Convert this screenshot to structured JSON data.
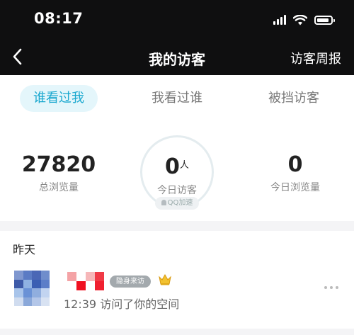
{
  "status_bar": {
    "time": "08:17"
  },
  "nav": {
    "title": "我的访客",
    "right_action": "访客周报"
  },
  "tabs": [
    {
      "label": "谁看过我",
      "active": true
    },
    {
      "label": "我看过谁",
      "active": false
    },
    {
      "label": "被挡访客",
      "active": false
    }
  ],
  "stats": {
    "total_views": {
      "value": "27820",
      "label": "总浏览量"
    },
    "today_visitors": {
      "value": "0",
      "unit": "人",
      "label": "今日访客",
      "badge": "QQ加速"
    },
    "today_views": {
      "value": "0",
      "label": "今日浏览量"
    }
  },
  "visitors": {
    "section_title": "昨天",
    "items": [
      {
        "badge": "隐身来访",
        "subtitle": "12:39 访问了你的空间",
        "vip_icon": "crown-icon"
      }
    ]
  },
  "colors": {
    "accent": "#1aa8cf",
    "tab_active_bg": "#e4f6fb",
    "header_bg": "#0f0f10",
    "vip_gold": "#f2c230"
  }
}
